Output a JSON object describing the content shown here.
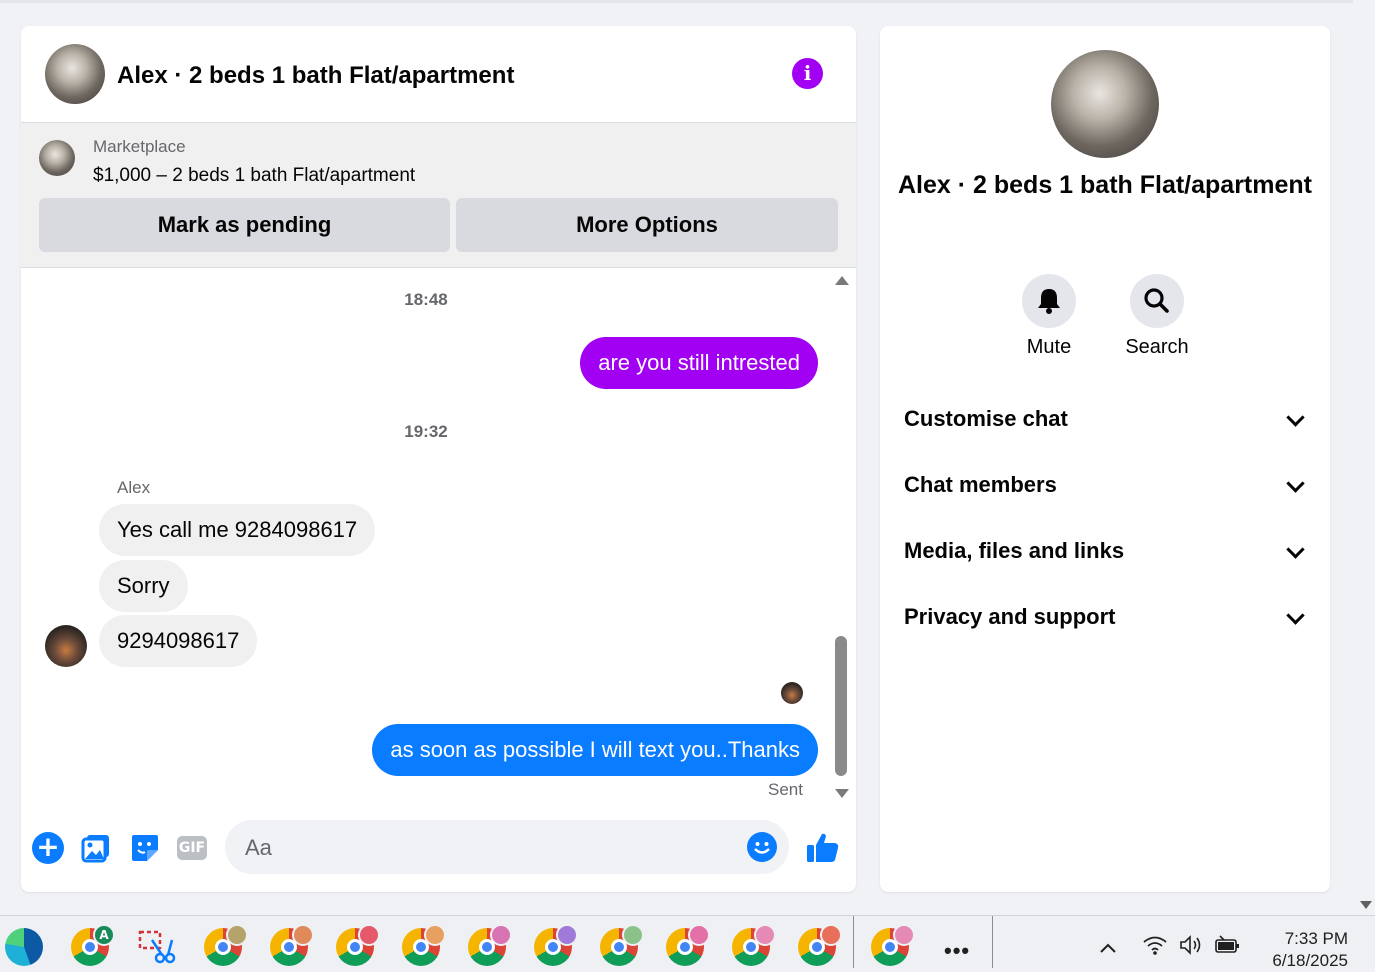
{
  "chat": {
    "title": "Alex · 2 beds 1 bath Flat/apartment",
    "marketplace_label": "Marketplace",
    "listing_price": "$1,000 – 2 beds 1 bath Flat/apartment",
    "mark_pending_label": "Mark as pending",
    "more_options_label": "More Options"
  },
  "messages": {
    "timestamp1": "18:48",
    "msg_out1": "are you still intrested",
    "timestamp2": "19:32",
    "sender": "Alex",
    "msg_in1": "Yes call me 9284098617",
    "msg_in2": "Sorry",
    "msg_in3": "9294098617",
    "msg_out2": "as soon as possible I will text you..Thanks",
    "status": "Sent"
  },
  "composer": {
    "placeholder": "Aa",
    "gif_label": "GIF"
  },
  "details": {
    "name": "Alex · 2 beds 1 bath Flat/apartment",
    "mute_label": "Mute",
    "search_label": "Search",
    "sections": [
      "Customise chat",
      "Chat members",
      "Media, files and links",
      "Privacy and support"
    ]
  },
  "taskbar": {
    "time": "7:33 PM",
    "date": "6/18/2025",
    "profile_badge": "A"
  },
  "colors": {
    "accent_purple": "#a100f2",
    "messenger_blue": "#0a7cff"
  }
}
